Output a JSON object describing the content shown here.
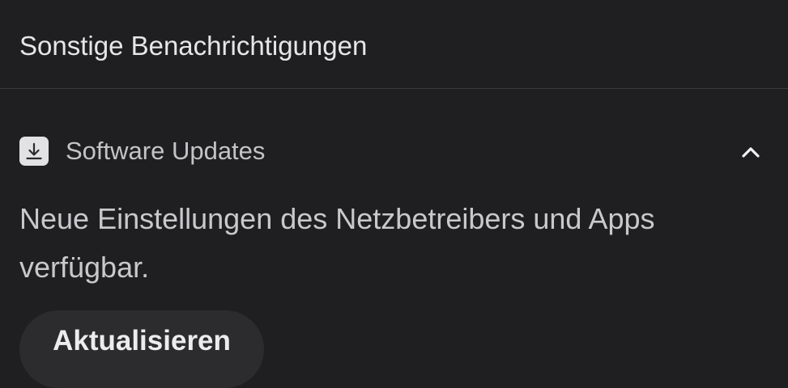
{
  "section": {
    "title": "Sonstige Benachrichtigungen"
  },
  "notification": {
    "icon": "download-icon",
    "app_name": "Software Updates",
    "collapse_icon": "chevron-up-icon",
    "message": "Neue Einstellungen des Netzbetreibers und Apps verfügbar.",
    "action_label": "Aktualisieren"
  },
  "colors": {
    "background": "#1f1f21",
    "button_background": "#2c2c2f",
    "icon_background": "#e2e2e4"
  }
}
